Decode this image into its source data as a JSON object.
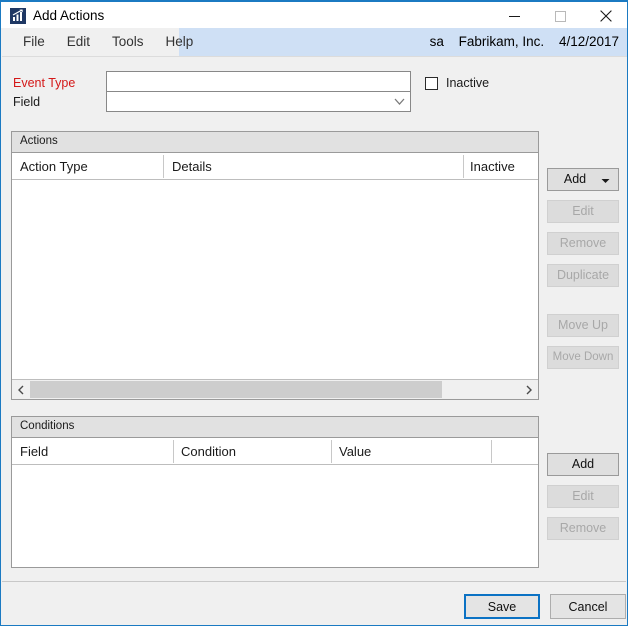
{
  "window": {
    "title": "Add Actions",
    "icon": "chart-app-icon",
    "controls": {
      "minimize": "minimize-icon",
      "maximize": "maximize-icon",
      "close": "close-icon"
    }
  },
  "menubar": {
    "items": [
      {
        "label": "File"
      },
      {
        "label": "Edit"
      },
      {
        "label": "Tools"
      },
      {
        "label": "Help"
      }
    ],
    "status": {
      "user": "sa",
      "company": "Fabrikam, Inc.",
      "date": "4/12/2017"
    }
  },
  "form": {
    "event_type": {
      "label": "Event Type",
      "value": "",
      "placeholder": "",
      "required_color": "#d41818"
    },
    "field": {
      "label": "Field",
      "value": "",
      "placeholder": "",
      "dropdown_icon": "chevron-down-icon"
    },
    "inactive": {
      "label": "Inactive",
      "checked": false
    }
  },
  "actions_panel": {
    "title": "Actions",
    "columns": [
      "Action Type",
      "Details",
      "Inactive"
    ],
    "rows": [],
    "scrollbar": {
      "left_arrow": "chevron-left-icon",
      "right_arrow": "chevron-right-icon"
    },
    "buttons": [
      {
        "label": "Add",
        "enabled": true,
        "split": true
      },
      {
        "label": "Edit",
        "enabled": false,
        "split": false
      },
      {
        "label": "Remove",
        "enabled": false,
        "split": false
      },
      {
        "label": "Duplicate",
        "enabled": false,
        "split": false
      },
      {
        "label": "Move Up",
        "enabled": false,
        "split": false
      },
      {
        "label": "Move Down",
        "enabled": false,
        "split": false
      }
    ]
  },
  "conditions_panel": {
    "title": "Conditions",
    "columns": [
      "Field",
      "Condition",
      "Value",
      ""
    ],
    "rows": [],
    "buttons": [
      {
        "label": "Add",
        "enabled": true
      },
      {
        "label": "Edit",
        "enabled": false
      },
      {
        "label": "Remove",
        "enabled": false
      }
    ]
  },
  "footer": {
    "save_label": "Save",
    "cancel_label": "Cancel"
  },
  "colors": {
    "accent": "#1b7ac2",
    "required": "#d41818",
    "menu_highlight": "#cfe0f5",
    "panel_header": "#e1e1e1"
  }
}
